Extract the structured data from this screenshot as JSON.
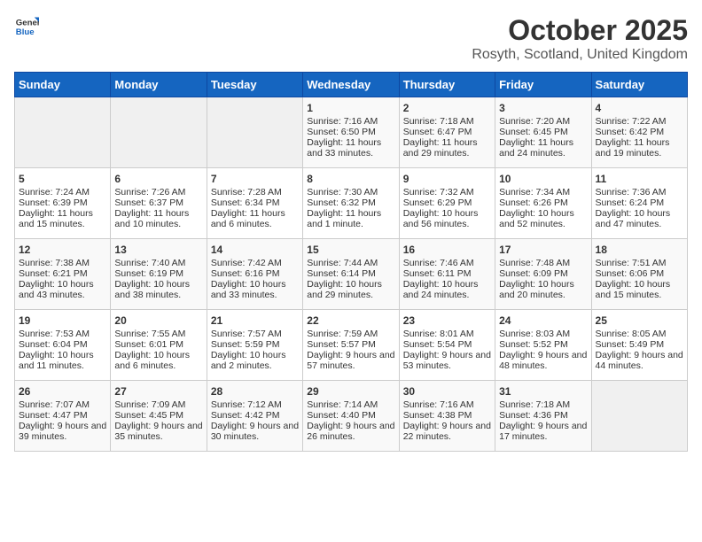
{
  "header": {
    "logo_general": "General",
    "logo_blue": "Blue",
    "month_title": "October 2025",
    "location": "Rosyth, Scotland, United Kingdom"
  },
  "days_of_week": [
    "Sunday",
    "Monday",
    "Tuesday",
    "Wednesday",
    "Thursday",
    "Friday",
    "Saturday"
  ],
  "weeks": [
    [
      {
        "day": "",
        "sunrise": "",
        "sunset": "",
        "daylight": ""
      },
      {
        "day": "",
        "sunrise": "",
        "sunset": "",
        "daylight": ""
      },
      {
        "day": "",
        "sunrise": "",
        "sunset": "",
        "daylight": ""
      },
      {
        "day": "1",
        "sunrise": "Sunrise: 7:16 AM",
        "sunset": "Sunset: 6:50 PM",
        "daylight": "Daylight: 11 hours and 33 minutes."
      },
      {
        "day": "2",
        "sunrise": "Sunrise: 7:18 AM",
        "sunset": "Sunset: 6:47 PM",
        "daylight": "Daylight: 11 hours and 29 minutes."
      },
      {
        "day": "3",
        "sunrise": "Sunrise: 7:20 AM",
        "sunset": "Sunset: 6:45 PM",
        "daylight": "Daylight: 11 hours and 24 minutes."
      },
      {
        "day": "4",
        "sunrise": "Sunrise: 7:22 AM",
        "sunset": "Sunset: 6:42 PM",
        "daylight": "Daylight: 11 hours and 19 minutes."
      }
    ],
    [
      {
        "day": "5",
        "sunrise": "Sunrise: 7:24 AM",
        "sunset": "Sunset: 6:39 PM",
        "daylight": "Daylight: 11 hours and 15 minutes."
      },
      {
        "day": "6",
        "sunrise": "Sunrise: 7:26 AM",
        "sunset": "Sunset: 6:37 PM",
        "daylight": "Daylight: 11 hours and 10 minutes."
      },
      {
        "day": "7",
        "sunrise": "Sunrise: 7:28 AM",
        "sunset": "Sunset: 6:34 PM",
        "daylight": "Daylight: 11 hours and 6 minutes."
      },
      {
        "day": "8",
        "sunrise": "Sunrise: 7:30 AM",
        "sunset": "Sunset: 6:32 PM",
        "daylight": "Daylight: 11 hours and 1 minute."
      },
      {
        "day": "9",
        "sunrise": "Sunrise: 7:32 AM",
        "sunset": "Sunset: 6:29 PM",
        "daylight": "Daylight: 10 hours and 56 minutes."
      },
      {
        "day": "10",
        "sunrise": "Sunrise: 7:34 AM",
        "sunset": "Sunset: 6:26 PM",
        "daylight": "Daylight: 10 hours and 52 minutes."
      },
      {
        "day": "11",
        "sunrise": "Sunrise: 7:36 AM",
        "sunset": "Sunset: 6:24 PM",
        "daylight": "Daylight: 10 hours and 47 minutes."
      }
    ],
    [
      {
        "day": "12",
        "sunrise": "Sunrise: 7:38 AM",
        "sunset": "Sunset: 6:21 PM",
        "daylight": "Daylight: 10 hours and 43 minutes."
      },
      {
        "day": "13",
        "sunrise": "Sunrise: 7:40 AM",
        "sunset": "Sunset: 6:19 PM",
        "daylight": "Daylight: 10 hours and 38 minutes."
      },
      {
        "day": "14",
        "sunrise": "Sunrise: 7:42 AM",
        "sunset": "Sunset: 6:16 PM",
        "daylight": "Daylight: 10 hours and 33 minutes."
      },
      {
        "day": "15",
        "sunrise": "Sunrise: 7:44 AM",
        "sunset": "Sunset: 6:14 PM",
        "daylight": "Daylight: 10 hours and 29 minutes."
      },
      {
        "day": "16",
        "sunrise": "Sunrise: 7:46 AM",
        "sunset": "Sunset: 6:11 PM",
        "daylight": "Daylight: 10 hours and 24 minutes."
      },
      {
        "day": "17",
        "sunrise": "Sunrise: 7:48 AM",
        "sunset": "Sunset: 6:09 PM",
        "daylight": "Daylight: 10 hours and 20 minutes."
      },
      {
        "day": "18",
        "sunrise": "Sunrise: 7:51 AM",
        "sunset": "Sunset: 6:06 PM",
        "daylight": "Daylight: 10 hours and 15 minutes."
      }
    ],
    [
      {
        "day": "19",
        "sunrise": "Sunrise: 7:53 AM",
        "sunset": "Sunset: 6:04 PM",
        "daylight": "Daylight: 10 hours and 11 minutes."
      },
      {
        "day": "20",
        "sunrise": "Sunrise: 7:55 AM",
        "sunset": "Sunset: 6:01 PM",
        "daylight": "Daylight: 10 hours and 6 minutes."
      },
      {
        "day": "21",
        "sunrise": "Sunrise: 7:57 AM",
        "sunset": "Sunset: 5:59 PM",
        "daylight": "Daylight: 10 hours and 2 minutes."
      },
      {
        "day": "22",
        "sunrise": "Sunrise: 7:59 AM",
        "sunset": "Sunset: 5:57 PM",
        "daylight": "Daylight: 9 hours and 57 minutes."
      },
      {
        "day": "23",
        "sunrise": "Sunrise: 8:01 AM",
        "sunset": "Sunset: 5:54 PM",
        "daylight": "Daylight: 9 hours and 53 minutes."
      },
      {
        "day": "24",
        "sunrise": "Sunrise: 8:03 AM",
        "sunset": "Sunset: 5:52 PM",
        "daylight": "Daylight: 9 hours and 48 minutes."
      },
      {
        "day": "25",
        "sunrise": "Sunrise: 8:05 AM",
        "sunset": "Sunset: 5:49 PM",
        "daylight": "Daylight: 9 hours and 44 minutes."
      }
    ],
    [
      {
        "day": "26",
        "sunrise": "Sunrise: 7:07 AM",
        "sunset": "Sunset: 4:47 PM",
        "daylight": "Daylight: 9 hours and 39 minutes."
      },
      {
        "day": "27",
        "sunrise": "Sunrise: 7:09 AM",
        "sunset": "Sunset: 4:45 PM",
        "daylight": "Daylight: 9 hours and 35 minutes."
      },
      {
        "day": "28",
        "sunrise": "Sunrise: 7:12 AM",
        "sunset": "Sunset: 4:42 PM",
        "daylight": "Daylight: 9 hours and 30 minutes."
      },
      {
        "day": "29",
        "sunrise": "Sunrise: 7:14 AM",
        "sunset": "Sunset: 4:40 PM",
        "daylight": "Daylight: 9 hours and 26 minutes."
      },
      {
        "day": "30",
        "sunrise": "Sunrise: 7:16 AM",
        "sunset": "Sunset: 4:38 PM",
        "daylight": "Daylight: 9 hours and 22 minutes."
      },
      {
        "day": "31",
        "sunrise": "Sunrise: 7:18 AM",
        "sunset": "Sunset: 4:36 PM",
        "daylight": "Daylight: 9 hours and 17 minutes."
      },
      {
        "day": "",
        "sunrise": "",
        "sunset": "",
        "daylight": ""
      }
    ]
  ]
}
